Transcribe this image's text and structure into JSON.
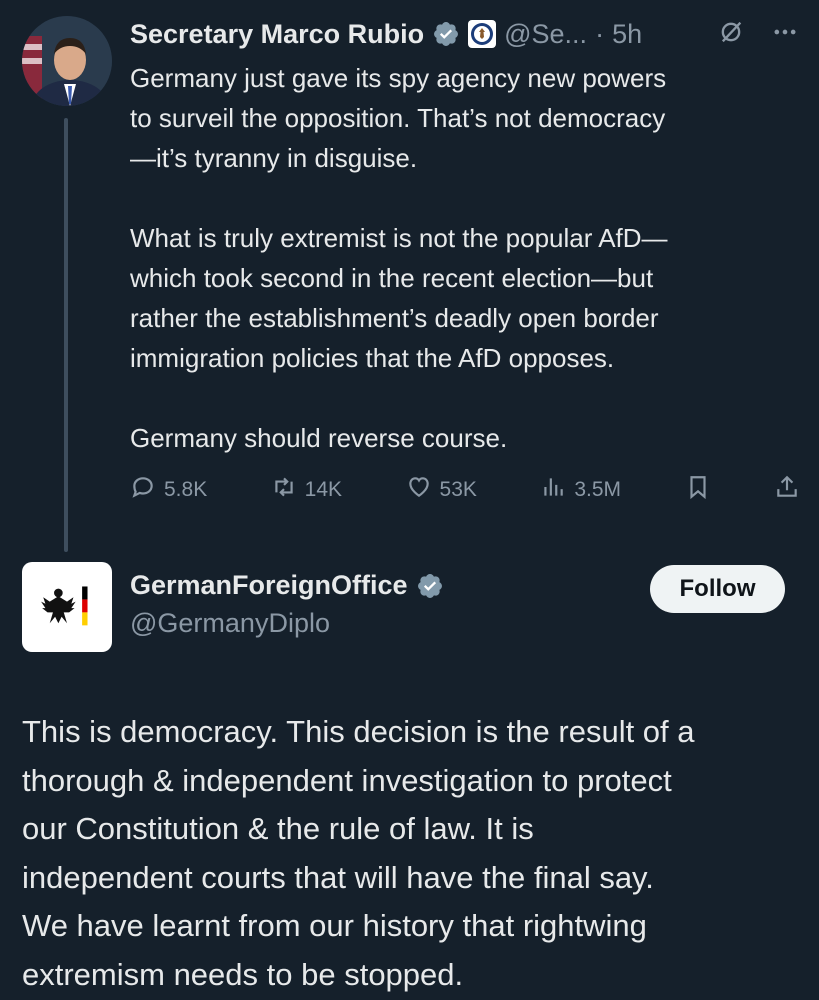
{
  "tweet1": {
    "display_name": "Secretary Marco Rubio",
    "handle": "@Se...",
    "separator": "·",
    "time": "5h",
    "text": "Germany just gave its spy agency new powers\nto surveil the opposition.  That’s not democracy\n—it’s tyranny in disguise.\n\nWhat is truly extremist is not the popular AfD—\nwhich took second in the recent election—but\nrather the establishment’s deadly open border\nimmigration policies that the AfD opposes.\n\nGermany should reverse course.",
    "stats": {
      "replies": "5.8K",
      "retweets": "14K",
      "likes": "53K",
      "views": "3.5M"
    },
    "icons": [
      "verified-badge-icon",
      "state-department-seal-icon",
      "grok-icon",
      "more-icon",
      "reply-icon",
      "retweet-icon",
      "like-icon",
      "views-icon",
      "bookmark-icon",
      "share-icon"
    ]
  },
  "tweet2": {
    "display_name": "GermanForeignOffice",
    "handle": "@GermanyDiplo",
    "follow_label": "Follow",
    "text": "This is democracy. This decision is the result of a\nthorough & independent investigation to protect\nour Constitution & the rule of law. It is\nindependent courts that will have the final say.\nWe have learnt from our history that rightwing\nextremism needs to be stopped."
  },
  "colors": {
    "background": "#15202b",
    "text": "#e7e9ea",
    "muted": "#8b98a5",
    "verified": "#829aab",
    "follow_bg": "#eff3f4"
  }
}
